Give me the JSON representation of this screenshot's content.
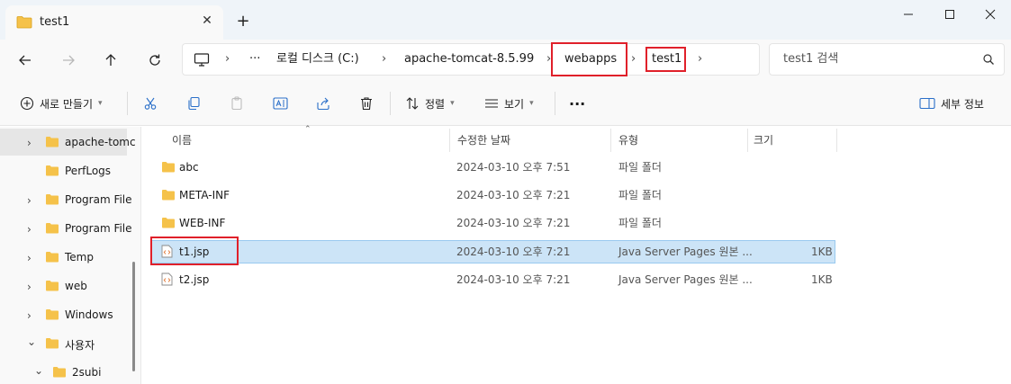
{
  "tab": {
    "title": "test1",
    "close_glyph": "✕",
    "new_glyph": "+"
  },
  "breadcrumb": {
    "more": "···",
    "items": [
      "로컬 디스크 (C:)",
      "apache-tomcat-8.5.99",
      "webapps",
      "test1"
    ],
    "separator": "›"
  },
  "search": {
    "placeholder": "test1 검색"
  },
  "toolbar": {
    "new_label": "새로 만들기",
    "sort_label": "정렬",
    "view_label": "보기",
    "more_label": "···",
    "details_label": "세부 정보"
  },
  "sidebar": {
    "items": [
      {
        "label": "apache-tomc",
        "expand": "›"
      },
      {
        "label": "PerfLogs",
        "expand": ""
      },
      {
        "label": "Program File",
        "expand": "›"
      },
      {
        "label": "Program File",
        "expand": "›"
      },
      {
        "label": "Temp",
        "expand": "›"
      },
      {
        "label": "web",
        "expand": "›"
      },
      {
        "label": "Windows",
        "expand": "›"
      },
      {
        "label": "사용자",
        "expand": "⌄"
      },
      {
        "label": "2subi",
        "expand": "⌄"
      }
    ]
  },
  "columns": {
    "name": "이름",
    "date": "수정한 날짜",
    "type": "유형",
    "size": "크기",
    "sort_glyph": "⌃"
  },
  "files": [
    {
      "name": "abc",
      "date": "2024-03-10 오후 7:51",
      "type": "파일 폴더",
      "size": ""
    },
    {
      "name": "META-INF",
      "date": "2024-03-10 오후 7:21",
      "type": "파일 폴더",
      "size": ""
    },
    {
      "name": "WEB-INF",
      "date": "2024-03-10 오후 7:21",
      "type": "파일 폴더",
      "size": ""
    },
    {
      "name": "t1.jsp",
      "date": "2024-03-10 오후 7:21",
      "type": "Java Server Pages 원본 ...",
      "size": "1KB"
    },
    {
      "name": "t2.jsp",
      "date": "2024-03-10 오후 7:21",
      "type": "Java Server Pages 원본 ...",
      "size": "1KB"
    }
  ],
  "colors": {
    "folder": "#f5c24a",
    "selection": "#cce4f7",
    "highlight_box": "#e0202a"
  }
}
